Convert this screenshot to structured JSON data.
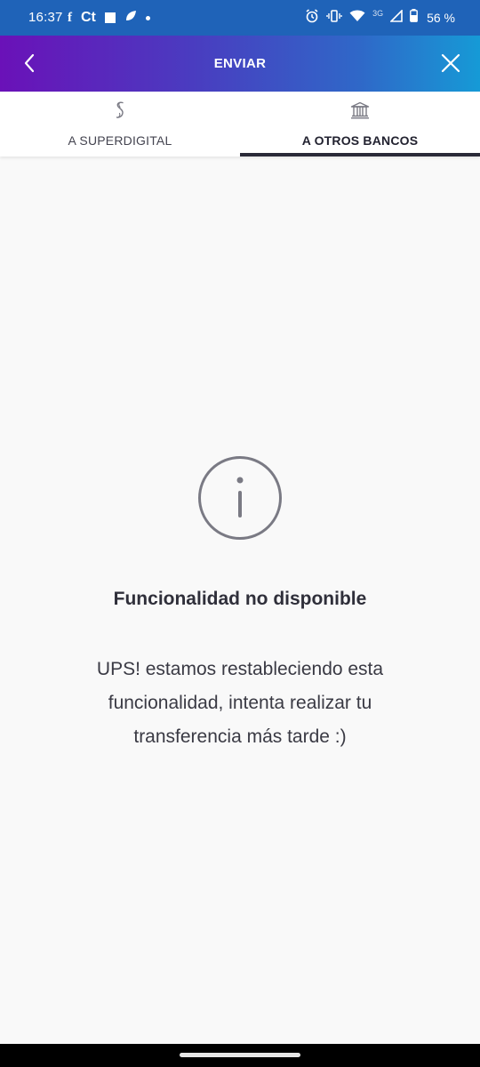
{
  "status_bar": {
    "time": "16:37",
    "left_icons": [
      "f",
      "Ct"
    ],
    "network_label": "3G",
    "battery": "56 %"
  },
  "header": {
    "title": "ENVIAR"
  },
  "tabs": [
    {
      "label": "A SUPERDIGITAL",
      "icon": "superdigital-s-icon",
      "selected": false
    },
    {
      "label": "A OTROS BANCOS",
      "icon": "bank-icon",
      "selected": true
    }
  ],
  "message": {
    "icon": "info-icon",
    "title": "Funcionalidad no disponible",
    "body": "UPS! estamos restableciendo esta funcionalidad, intenta realizar tu transferencia más tarde :)"
  },
  "colors": {
    "status_bar_bg": "#1f63b8",
    "header_gradient_start": "#6a11b8",
    "header_gradient_end": "#169ad6",
    "tab_indicator": "#2a2a38",
    "background": "#f9f9f9",
    "icon_gray": "#7a7a84"
  }
}
